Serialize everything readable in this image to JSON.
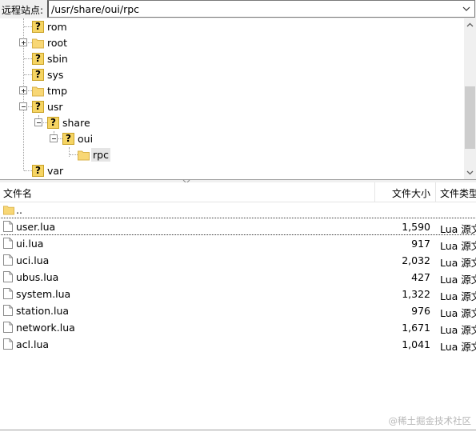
{
  "pathbar": {
    "label": "远程站点:",
    "value": "/usr/share/oui/rpc",
    "icon": "chevron-down-icon"
  },
  "tree": {
    "nodes": [
      {
        "label": "rom",
        "icon": "unknown-folder-icon",
        "expander": ""
      },
      {
        "label": "root",
        "icon": "folder-icon",
        "expander": "plus"
      },
      {
        "label": "sbin",
        "icon": "unknown-folder-icon",
        "expander": ""
      },
      {
        "label": "sys",
        "icon": "unknown-folder-icon",
        "expander": ""
      },
      {
        "label": "tmp",
        "icon": "folder-icon",
        "expander": "plus"
      },
      {
        "label": "usr",
        "icon": "unknown-folder-icon",
        "expander": "minus"
      },
      {
        "label": "share",
        "icon": "unknown-folder-icon",
        "expander": "minus"
      },
      {
        "label": "oui",
        "icon": "unknown-folder-icon",
        "expander": "minus"
      },
      {
        "label": "rpc",
        "icon": "folder-icon",
        "expander": "",
        "selected": true
      },
      {
        "label": "var",
        "icon": "unknown-folder-icon",
        "expander": ""
      }
    ]
  },
  "filelist": {
    "columns": {
      "name": "文件名",
      "size": "文件大小",
      "type": "文件类型"
    },
    "parent": {
      "name": "..",
      "icon": "folder-icon"
    },
    "files": [
      {
        "name": "user.lua",
        "size": "1,590",
        "type": "Lua 源文件",
        "icon": "file-icon"
      },
      {
        "name": "ui.lua",
        "size": "917",
        "type": "Lua 源文件",
        "icon": "file-icon"
      },
      {
        "name": "uci.lua",
        "size": "2,032",
        "type": "Lua 源文件",
        "icon": "file-icon"
      },
      {
        "name": "ubus.lua",
        "size": "427",
        "type": "Lua 源文件",
        "icon": "file-icon"
      },
      {
        "name": "system.lua",
        "size": "1,322",
        "type": "Lua 源文件",
        "icon": "file-icon"
      },
      {
        "name": "station.lua",
        "size": "976",
        "type": "Lua 源文件",
        "icon": "file-icon"
      },
      {
        "name": "network.lua",
        "size": "1,671",
        "type": "Lua 源文件",
        "icon": "file-icon"
      },
      {
        "name": "acl.lua",
        "size": "1,041",
        "type": "Lua 源文件",
        "icon": "file-icon"
      }
    ]
  },
  "watermark": "@稀土掘金技术社区",
  "colors": {
    "folder": "#f8d775",
    "unknown_folder": "#f5d463",
    "selection": "#e5e5e5"
  }
}
